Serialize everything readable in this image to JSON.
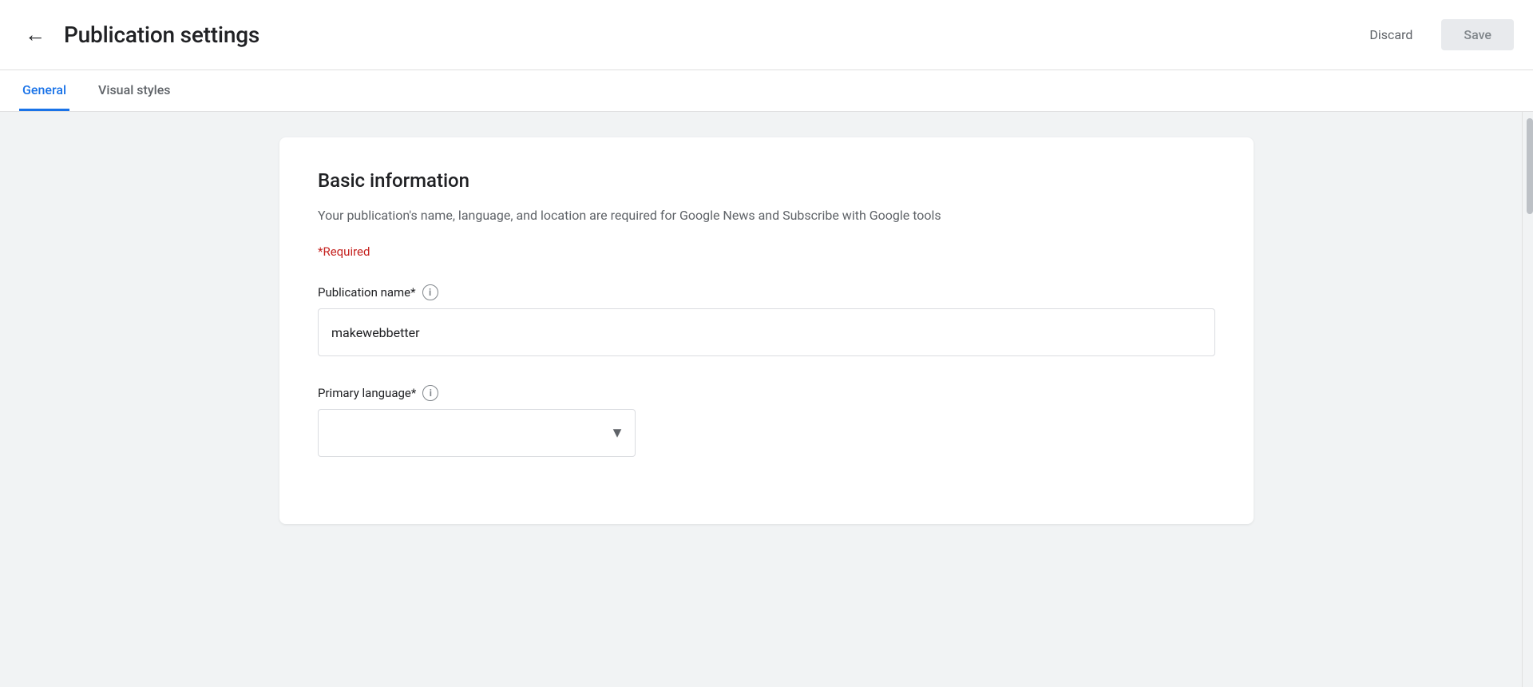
{
  "header": {
    "back_label": "←",
    "title": "Publication settings",
    "discard_label": "Discard",
    "save_label": "Save"
  },
  "tabs": [
    {
      "id": "general",
      "label": "General",
      "active": true
    },
    {
      "id": "visual-styles",
      "label": "Visual styles",
      "active": false
    }
  ],
  "card": {
    "title": "Basic information",
    "description": "Your publication's name, language, and location are required for Google News and Subscribe with Google tools",
    "required_label": "*Required",
    "fields": {
      "publication_name": {
        "label": "Publication name*",
        "value": "makewebbetter",
        "placeholder": ""
      },
      "primary_language": {
        "label": "Primary language*",
        "value": "",
        "placeholder": ""
      }
    }
  }
}
